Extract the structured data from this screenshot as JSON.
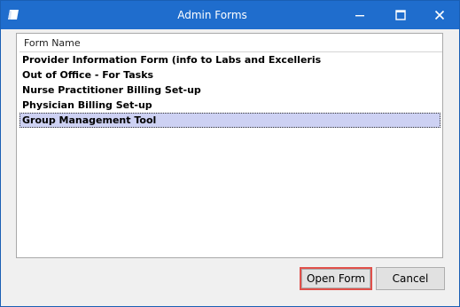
{
  "window": {
    "title": "Admin Forms"
  },
  "titlebar": {
    "app_icon": "form-window-icon",
    "minimize_icon": "minimize-icon",
    "maximize_icon": "maximize-icon",
    "close_icon": "close-icon"
  },
  "list": {
    "column_header": "Form Name",
    "items": [
      {
        "label": "Provider Information Form (info to Labs and Excelleris",
        "selected": false
      },
      {
        "label": "Out of Office - For Tasks",
        "selected": false
      },
      {
        "label": "Nurse Practitioner Billing Set-up",
        "selected": false
      },
      {
        "label": "Physician Billing Set-up",
        "selected": false
      },
      {
        "label": "Group Management Tool",
        "selected": true
      }
    ],
    "selected_color": "#cdd1f3"
  },
  "buttons": {
    "open_label": "Open Form",
    "cancel_label": "Cancel",
    "highlight_color": "#e0504a"
  },
  "colors": {
    "titlebar": "#1f6dcd"
  }
}
